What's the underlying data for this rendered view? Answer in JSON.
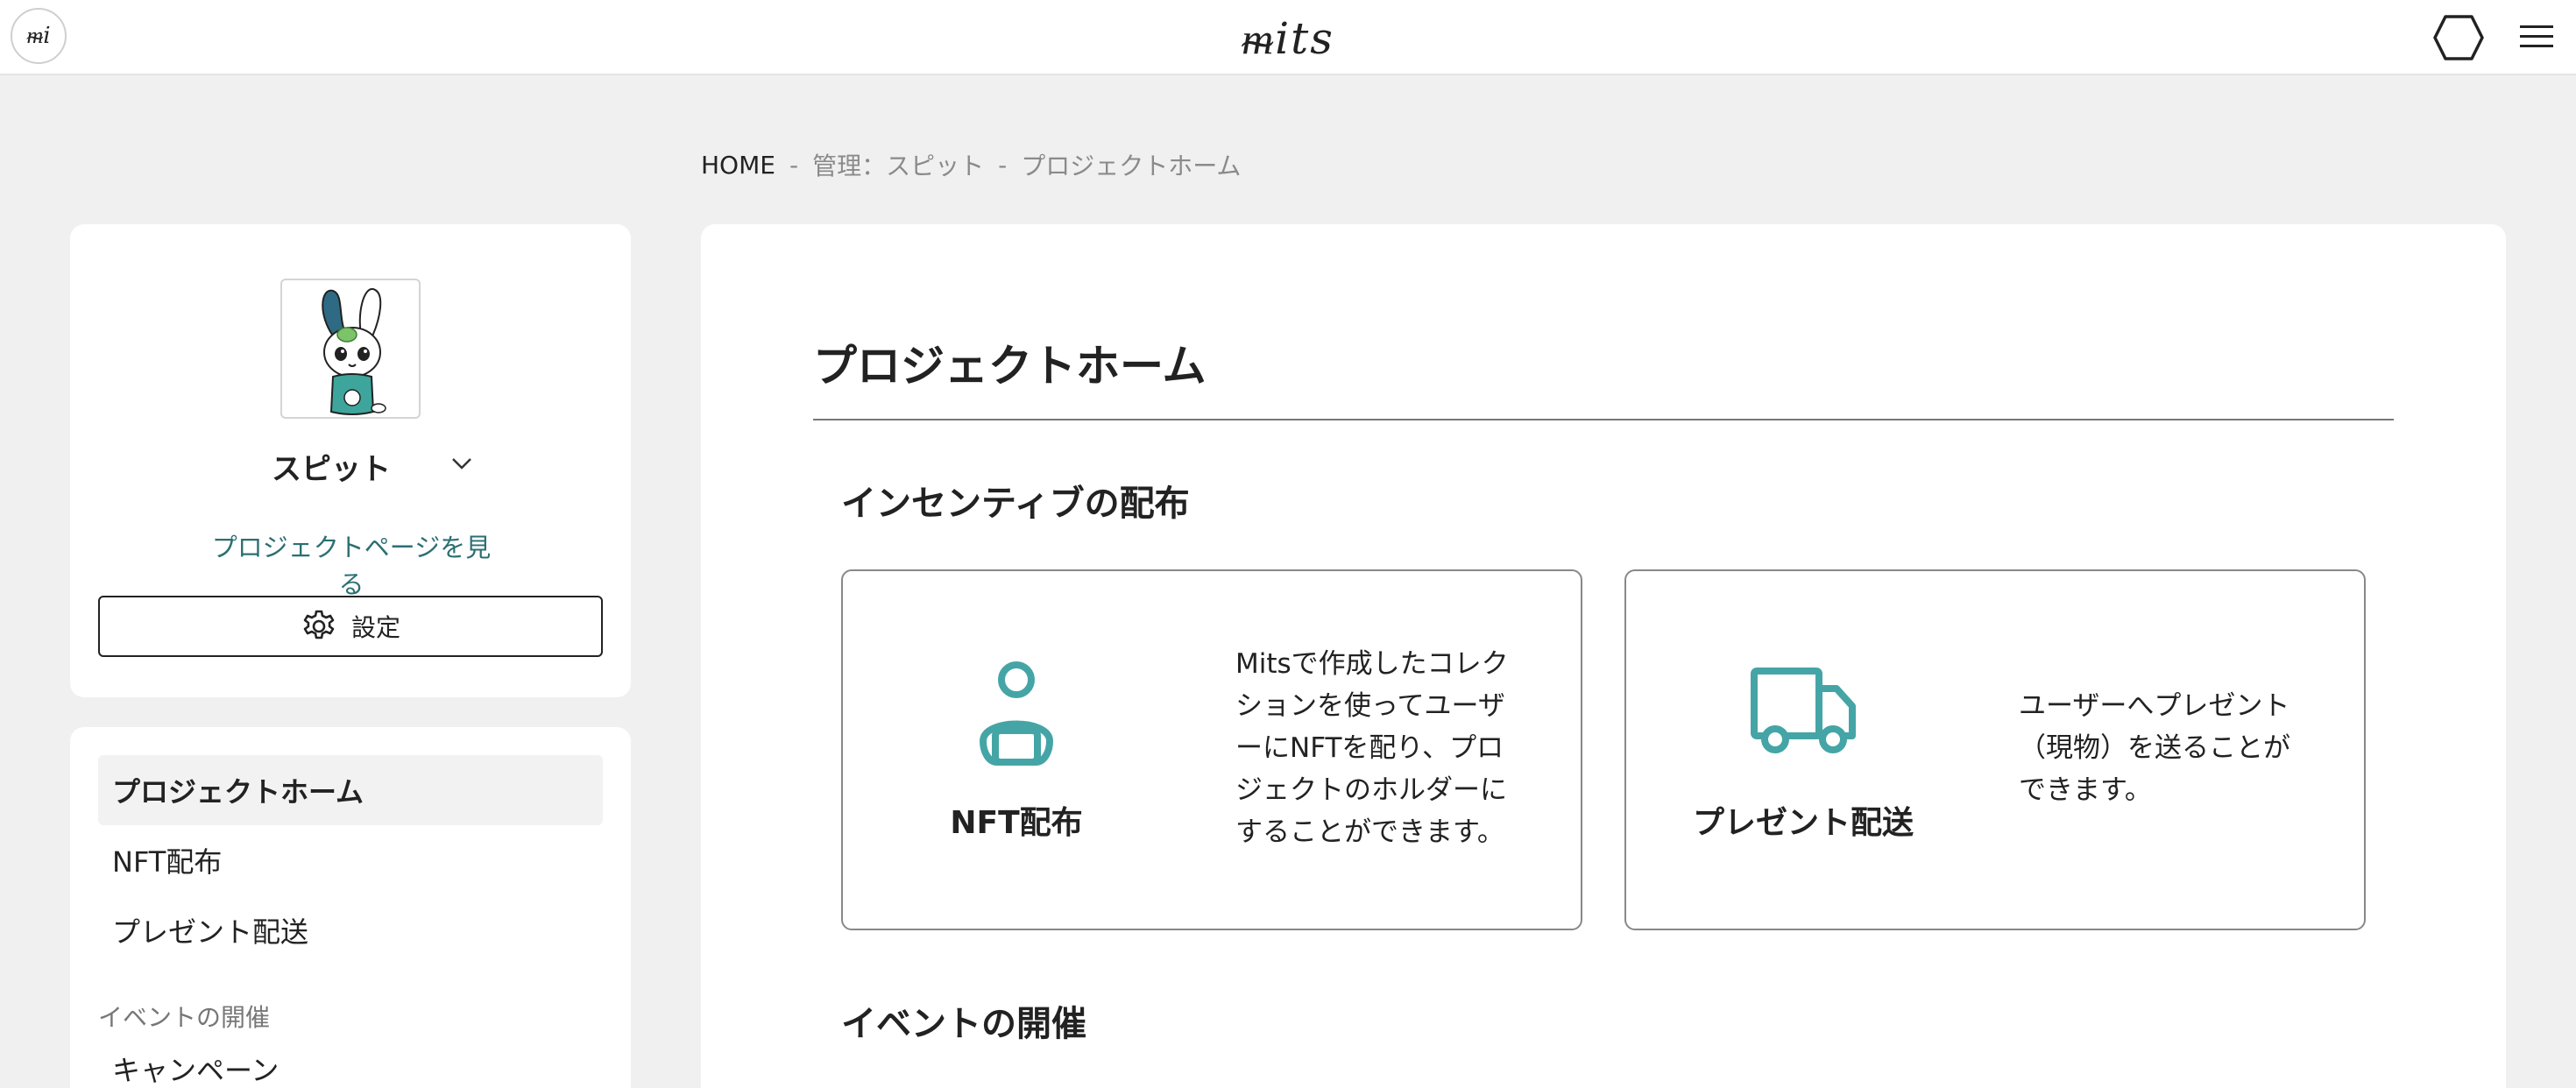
{
  "header": {
    "mini_logo_text": "ᵯi",
    "logo_text": "ᵯits",
    "icons": [
      "hexagon-icon",
      "hamburger-menu-icon"
    ]
  },
  "breadcrumb": {
    "home": "HOME",
    "separator": "-",
    "level1": "管理：スピット",
    "level2": "プロジェクトホーム"
  },
  "project": {
    "name": "スピット",
    "view_page_link": "プロジェクトページを見る",
    "settings_label": "設定"
  },
  "sidebar": {
    "items": [
      {
        "label": "プロジェクトホーム",
        "active": true
      },
      {
        "label": "NFT配布",
        "active": false
      },
      {
        "label": "プレゼント配送",
        "active": false
      }
    ],
    "section_event": "イベントの開催",
    "event_items": [
      {
        "label": "キャンペーン"
      }
    ]
  },
  "main": {
    "title": "プロジェクトホーム",
    "sections": {
      "incentive": "インセンティブの配布",
      "event": "イベントの開催"
    },
    "cards": [
      {
        "icon": "user-icon",
        "label": "NFT配布",
        "desc_lines": [
          "Mitsで作成したコレク",
          "ションを使ってユーザ",
          "ーにNFTを配り、プロ",
          "ジェクトのホルダーに",
          "することができます。"
        ]
      },
      {
        "icon": "truck-icon",
        "label": "プレゼント配送",
        "desc_lines": [
          "ユーザーへプレゼント",
          "（現物）を送ることが",
          "できます。"
        ]
      }
    ]
  },
  "colors": {
    "accent_teal": "#45a5a6",
    "link": "#2b6f73",
    "background": "#f0f0f0"
  }
}
